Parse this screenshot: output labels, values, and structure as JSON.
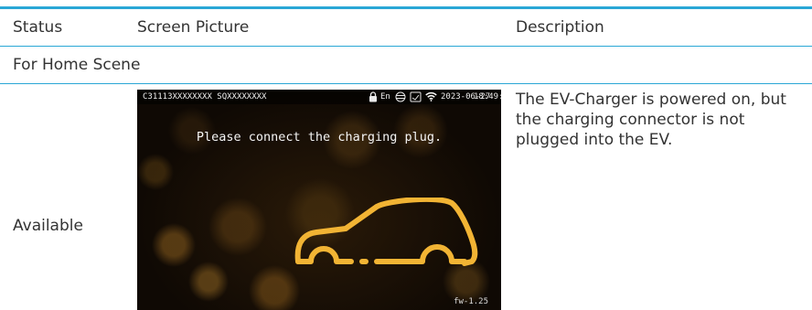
{
  "table": {
    "headers": {
      "status": "Status",
      "picture": "Screen Picture",
      "description": "Description"
    },
    "section": "For Home Scene",
    "rows": [
      {
        "status": "Available",
        "description": "The EV-Charger is powered on, but the charging connector is not plugged into the EV.",
        "screen": {
          "serial_left": "C31113XXXXXXXX SQXXXXXXXX",
          "lang": "En",
          "date": "2023-06-27",
          "time": "18:49:39",
          "prompt": "Please connect the charging plug.",
          "firmware": "fw-1.25"
        }
      }
    ]
  },
  "colors": {
    "accent_rule": "#2aa7d6",
    "car_outline": "#f2b434",
    "text": "#333333"
  },
  "icons": [
    "lock-icon",
    "globe-icon",
    "card-icon",
    "wifi-icon",
    "car-outline-icon"
  ]
}
